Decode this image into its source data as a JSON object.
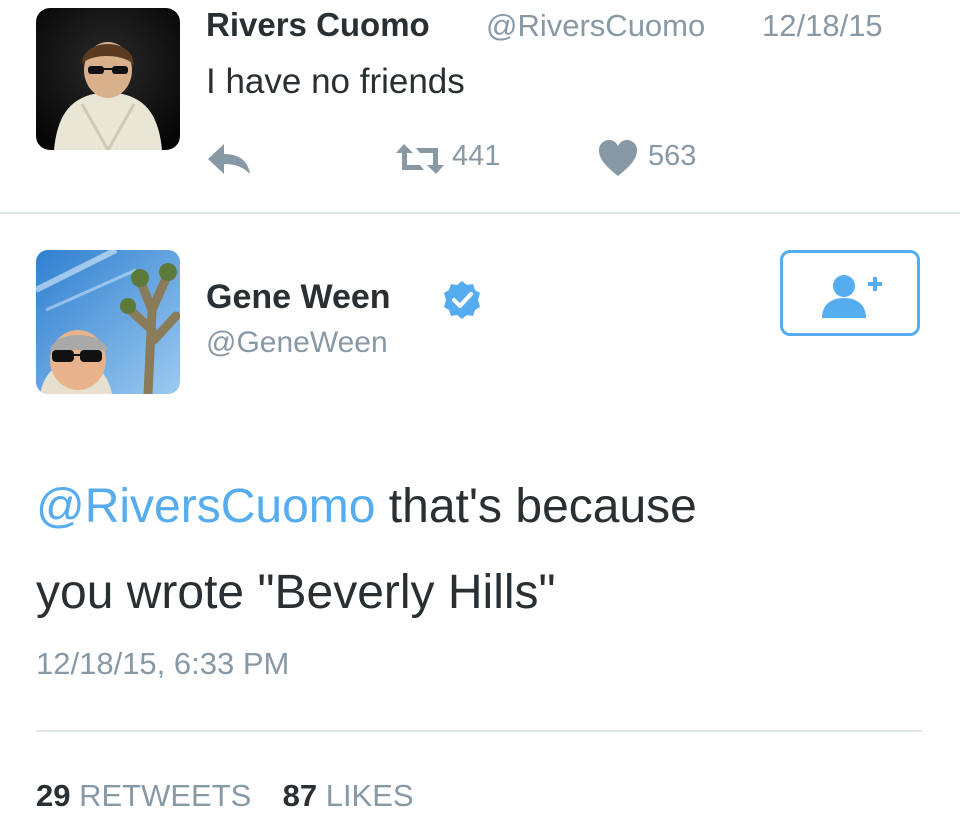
{
  "tweet_original": {
    "display_name": "Rivers Cuomo",
    "handle": "@RiversCuomo",
    "date": "12/18/15",
    "text": "I have no friends",
    "retweet_count": "441",
    "like_count": "563",
    "icons": {
      "reply": "reply-icon",
      "retweet": "retweet-icon",
      "like": "heart-icon"
    }
  },
  "tweet_reply": {
    "display_name": "Gene Ween",
    "handle": "@GeneWeen",
    "verified": true,
    "mention": "@RiversCuomo",
    "text_line1_rest": " that's because",
    "text_line2": "you wrote \"Beverly Hills\"",
    "timestamp": "12/18/15, 6:33 PM",
    "retweets_count": "29",
    "retweets_label": "RETWEETS",
    "likes_count": "87",
    "likes_label": "LIKES",
    "icons": {
      "verified": "verified-badge-icon",
      "follow": "follow-user-icon"
    }
  },
  "colors": {
    "accent": "#55acee",
    "text": "#292f33",
    "muted": "#8899a6",
    "divider": "#e1e8ed"
  }
}
